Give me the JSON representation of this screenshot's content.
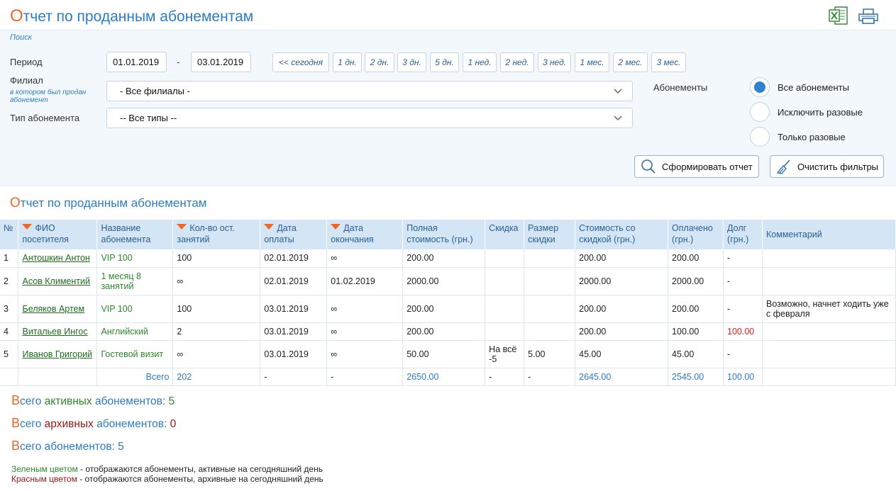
{
  "header": {
    "title_first": "О",
    "title_rest": "тчет по проданным абонементам",
    "excel_icon": "excel-icon",
    "print_icon": "printer-icon"
  },
  "filters": {
    "search_label": "Поиск",
    "period_label": "Период",
    "date_from": "01.01.2019",
    "date_sep": "-",
    "date_to": "03.01.2019",
    "ranges": [
      "<< сегодня",
      "1 дн.",
      "2 дн.",
      "3 дн.",
      "5 дн.",
      "1 нед.",
      "2 нед.",
      "3 нед.",
      "1 мес.",
      "2 мес.",
      "3 мес."
    ],
    "branch_label": "Филиал",
    "branch_sub": "в котором был продан абонемент",
    "branch_value": "- Все филиалы -",
    "type_label": "Тип абонемента",
    "type_value": "-- Все типы --",
    "subs_label": "Абонементы",
    "radio_options": [
      "Все абонементы",
      "Исключить разовые",
      "Только разовые"
    ],
    "radio_selected": 0,
    "generate_button": "Сформировать отчет",
    "clear_button": "Очистить фильтры"
  },
  "report": {
    "title_first": "О",
    "title_rest": "тчет по проданным абонементам",
    "columns": {
      "num": "№",
      "fio": "ФИО посетителя",
      "name": "Название абонемента",
      "count": "Кол-во ост. занятий",
      "pay_date": "Дата оплаты",
      "end_date": "Дата окончания",
      "full_cost": "Полная стоимость (грн.)",
      "discount": "Скидка",
      "discount_size": "Размер скидки",
      "disc_cost": "Стоимость со скидкой (грн.)",
      "paid": "Оплачено (грн.)",
      "debt": "Долг (грн.)",
      "comment": "Комментарий"
    },
    "rows": [
      {
        "num": "1",
        "fio": "Антошкин Антон",
        "name": "VIP 100",
        "count": "100",
        "pay_date": "02.01.2019",
        "end_date": "∞",
        "full_cost": "200.00",
        "discount": "",
        "discount_size": "",
        "disc_cost": "200.00",
        "paid": "200.00",
        "debt": "-",
        "comment": ""
      },
      {
        "num": "2",
        "fio": "Асов Климентий",
        "name": "1 месяц 8 занятий",
        "count": "∞",
        "pay_date": "02.01.2019",
        "end_date": "01.02.2019",
        "full_cost": "2000.00",
        "discount": "",
        "discount_size": "",
        "disc_cost": "2000.00",
        "paid": "2000.00",
        "debt": "-",
        "comment": ""
      },
      {
        "num": "3",
        "fio": "Беляков Артем",
        "name": "VIP 100",
        "count": "100",
        "pay_date": "03.01.2019",
        "end_date": "∞",
        "full_cost": "200.00",
        "discount": "",
        "discount_size": "",
        "disc_cost": "200.00",
        "paid": "200.00",
        "debt": "-",
        "comment": "Возможно, начнет ходить уже с февраля"
      },
      {
        "num": "4",
        "fio": "Витальев Ингос",
        "name": "Английский",
        "count": "2",
        "pay_date": "03.01.2019",
        "end_date": "∞",
        "full_cost": "200.00",
        "discount": "",
        "discount_size": "",
        "disc_cost": "200.00",
        "paid": "100.00",
        "debt": "100.00",
        "comment": ""
      },
      {
        "num": "5",
        "fio": "Иванов Григорий",
        "name": "Гостевой визит",
        "count": "∞",
        "pay_date": "03.01.2019",
        "end_date": "∞",
        "full_cost": "50.00",
        "discount": "На всё -5",
        "discount_size": "5.00",
        "disc_cost": "45.00",
        "paid": "45.00",
        "debt": "-",
        "comment": ""
      }
    ],
    "total": {
      "label": "Всего",
      "count": "202",
      "pay_date": "-",
      "end_date": "-",
      "full_cost": "2650.00",
      "discount": "-",
      "discount_size": "-",
      "disc_cost": "2645.00",
      "paid": "2545.00",
      "debt": "100.00"
    }
  },
  "summary": {
    "active_first": "В",
    "active_rest": "сего",
    "active_word": "активных",
    "active_tail": "абонементов:",
    "active_count": "5",
    "archive_first": "В",
    "archive_rest": "сего",
    "archive_word": "архивных",
    "archive_tail": "абонементов:",
    "archive_count": "0",
    "total_first": "В",
    "total_rest": "сего абонементов:",
    "total_count": "5"
  },
  "legend": {
    "green_label": "Зеленым цветом",
    "green_text": " - отображаются абонементы, активные на сегодняшний день",
    "red_label": "Красным цветом",
    "red_text": " - отображаются абонементы, архивные на сегодняшний день"
  },
  "colors": {
    "accent_orange": "#f26522",
    "accent_blue": "#2d7bc4",
    "active_green": "#2b8a2b",
    "archive_red": "#9b1414"
  }
}
